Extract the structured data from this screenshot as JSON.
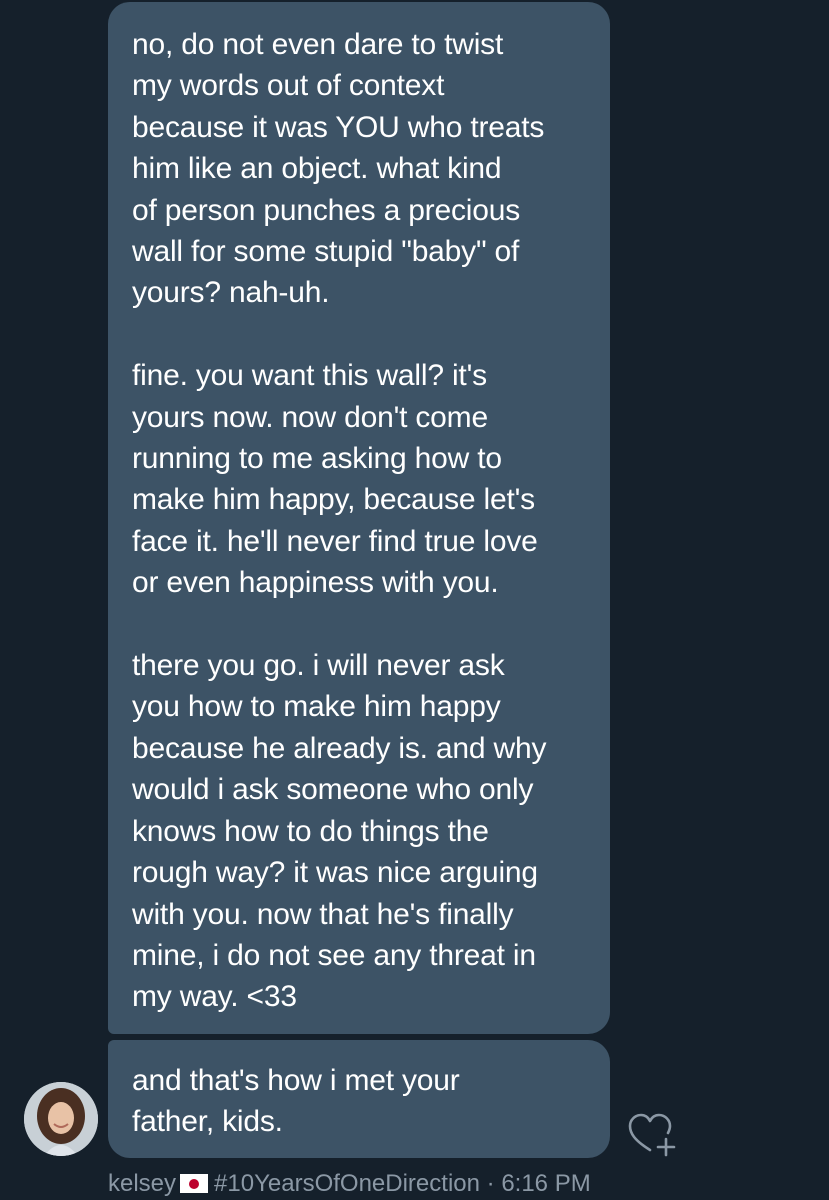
{
  "messages": [
    {
      "paragraphs": [
        "no, do not even dare to twist\nmy words out of context\nbecause it was YOU who treats\nhim like an object. what kind\nof person punches a precious\nwall for some stupid \"baby\" of\nyours? nah-uh.",
        "fine. you want this wall? it's\nyours now. now don't come\nrunning to me asking how to\nmake him happy, because let's\nface it. he'll never find true love\nor even happiness with you.",
        "there you go. i will never ask\nyou how to make him happy\nbecause he already is. and why\nwould i ask someone who only\nknows how to do things the\nrough way? it was nice arguing\nwith you. now that he's finally\nmine, i do not see any threat in\nmy way. <33"
      ]
    },
    {
      "paragraphs": [
        "and that's how i met your\nfather, kids."
      ]
    }
  ],
  "sender": {
    "name": "kelsey",
    "flag_icon": "japan-flag-icon",
    "tagline": "#10YearsOfOneDirection",
    "separator": "·",
    "time": "6:16 PM"
  },
  "actions": {
    "react_icon": "heart-plus-icon"
  },
  "colors": {
    "background": "#15202b",
    "bubble": "#3d5366",
    "text": "#ffffff",
    "meta_text": "#8b98a5"
  }
}
